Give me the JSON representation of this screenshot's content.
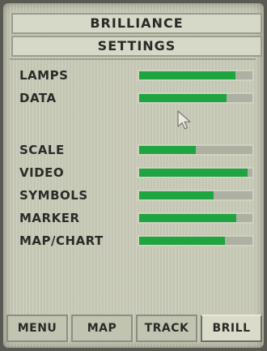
{
  "header": {
    "title_line1": "BRILLIANCE",
    "title_line2": "SETTINGS"
  },
  "settings": [
    {
      "label": "LAMPS",
      "level": 0.85
    },
    {
      "label": "DATA",
      "level": 0.77
    },
    {
      "label": "SCALE",
      "level": 0.5
    },
    {
      "label": "VIDEO",
      "level": 0.96
    },
    {
      "label": "SYMBOLS",
      "level": 0.66
    },
    {
      "label": "MARKER",
      "level": 0.86
    },
    {
      "label": "MAP/CHART",
      "level": 0.76
    }
  ],
  "tabs": [
    {
      "label": "MENU",
      "active": false
    },
    {
      "label": "MAP",
      "active": false
    },
    {
      "label": "TRACK",
      "active": false
    },
    {
      "label": "BRILL",
      "active": true
    }
  ],
  "colors": {
    "level_fill": "#1ea53f",
    "screen_background": "#c9cbb8"
  },
  "icons": {
    "pointer": "mouse-pointer-icon"
  }
}
